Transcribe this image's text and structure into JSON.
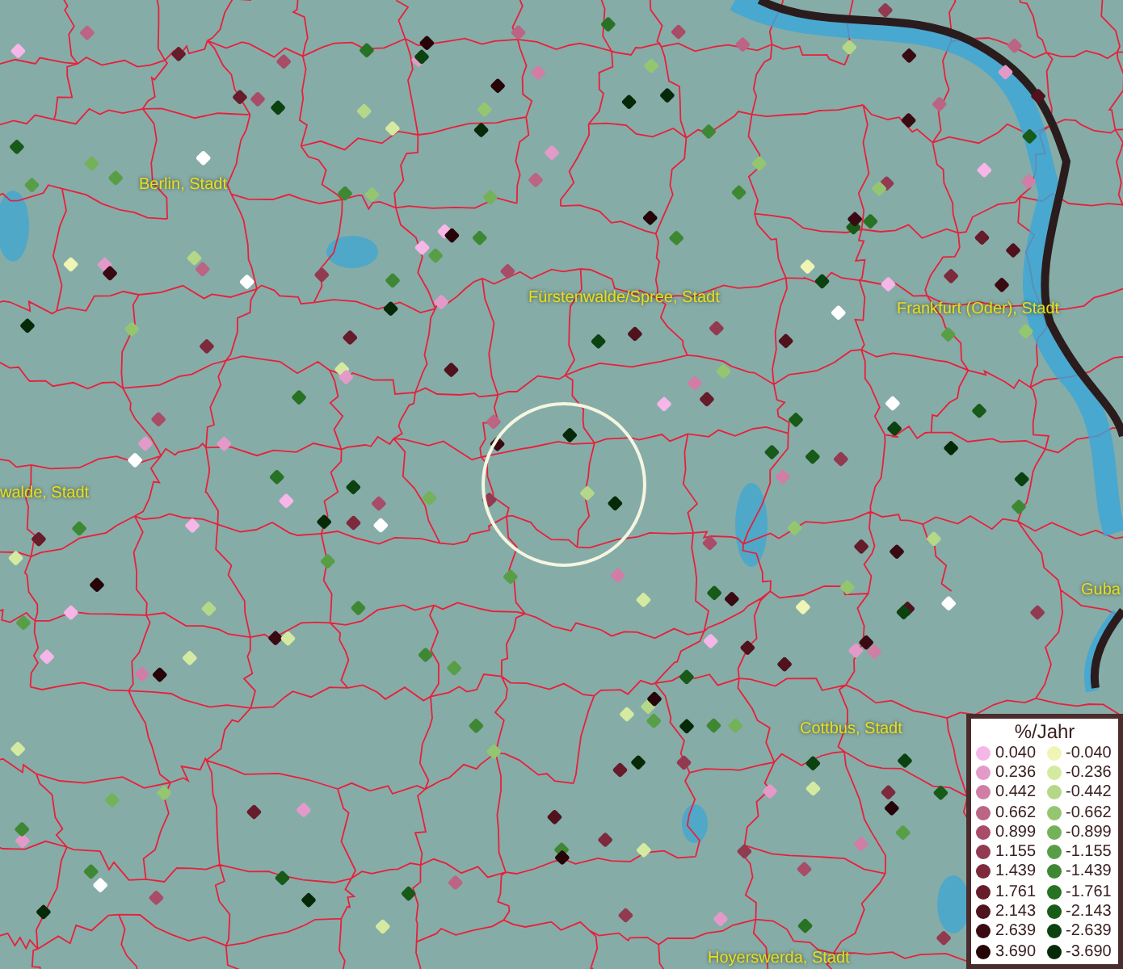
{
  "map_labels": [
    {
      "text": "Berlin, Stadt"
    },
    {
      "text": "Fürstenwalde/Spree, Stadt"
    },
    {
      "text": "Frankfurt (Oder), Stadt"
    },
    {
      "text": "walde, Stadt"
    },
    {
      "text": "Guba"
    },
    {
      "text": "Cottbus, Stadt"
    },
    {
      "text": "Hoyerswerda, Stadt"
    }
  ],
  "legend": {
    "title": "%/Jahr",
    "positive": [
      {
        "value": "0.040",
        "color": "#f6b6e8"
      },
      {
        "value": "0.236",
        "color": "#e49ac8"
      },
      {
        "value": "0.442",
        "color": "#d07ea6"
      },
      {
        "value": "0.662",
        "color": "#bc6484"
      },
      {
        "value": "0.899",
        "color": "#a84c68"
      },
      {
        "value": "1.155",
        "color": "#923a50"
      },
      {
        "value": "1.439",
        "color": "#7c2a3c"
      },
      {
        "value": "1.761",
        "color": "#661c2a"
      },
      {
        "value": "2.143",
        "color": "#50121c"
      },
      {
        "value": "2.639",
        "color": "#3a0a12"
      },
      {
        "value": "3.690",
        "color": "#260408"
      }
    ],
    "negative": [
      {
        "value": "-0.040",
        "color": "#f0f4b4"
      },
      {
        "value": "-0.236",
        "color": "#d4eaa0"
      },
      {
        "value": "-0.442",
        "color": "#b4d888"
      },
      {
        "value": "-0.662",
        "color": "#94c670"
      },
      {
        "value": "-0.899",
        "color": "#74b25a"
      },
      {
        "value": "-1.155",
        "color": "#589e46"
      },
      {
        "value": "-1.439",
        "color": "#3e8834"
      },
      {
        "value": "-1.761",
        "color": "#287224"
      },
      {
        "value": "-2.143",
        "color": "#185a18"
      },
      {
        "value": "-2.639",
        "color": "#0c4210"
      },
      {
        "value": "-3.690",
        "color": "#062a08"
      }
    ]
  }
}
